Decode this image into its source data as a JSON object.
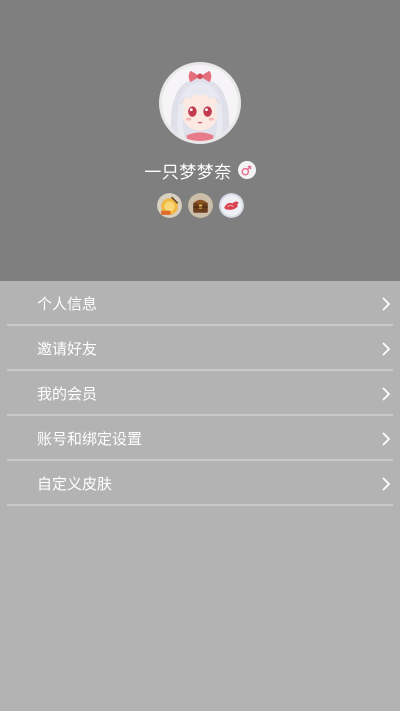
{
  "profile": {
    "username": "一只梦梦奈",
    "avatar_icon": "anime-avatar",
    "gender_icon": "male-symbol-icon",
    "gender_color": "#e5708c",
    "badges": [
      {
        "icon": "gold-medal-badge-icon"
      },
      {
        "icon": "treasure-chest-badge-icon"
      },
      {
        "icon": "red-bird-badge-icon"
      }
    ]
  },
  "menu": {
    "items": [
      {
        "label": "个人信息"
      },
      {
        "label": "邀请好友"
      },
      {
        "label": "我的会员"
      },
      {
        "label": "账号和绑定设置"
      },
      {
        "label": "自定义皮肤"
      }
    ]
  },
  "colors": {
    "header_bg": "#7f7f7f",
    "page_bg": "#b3b3b3",
    "divider": "#c9c9c9"
  }
}
